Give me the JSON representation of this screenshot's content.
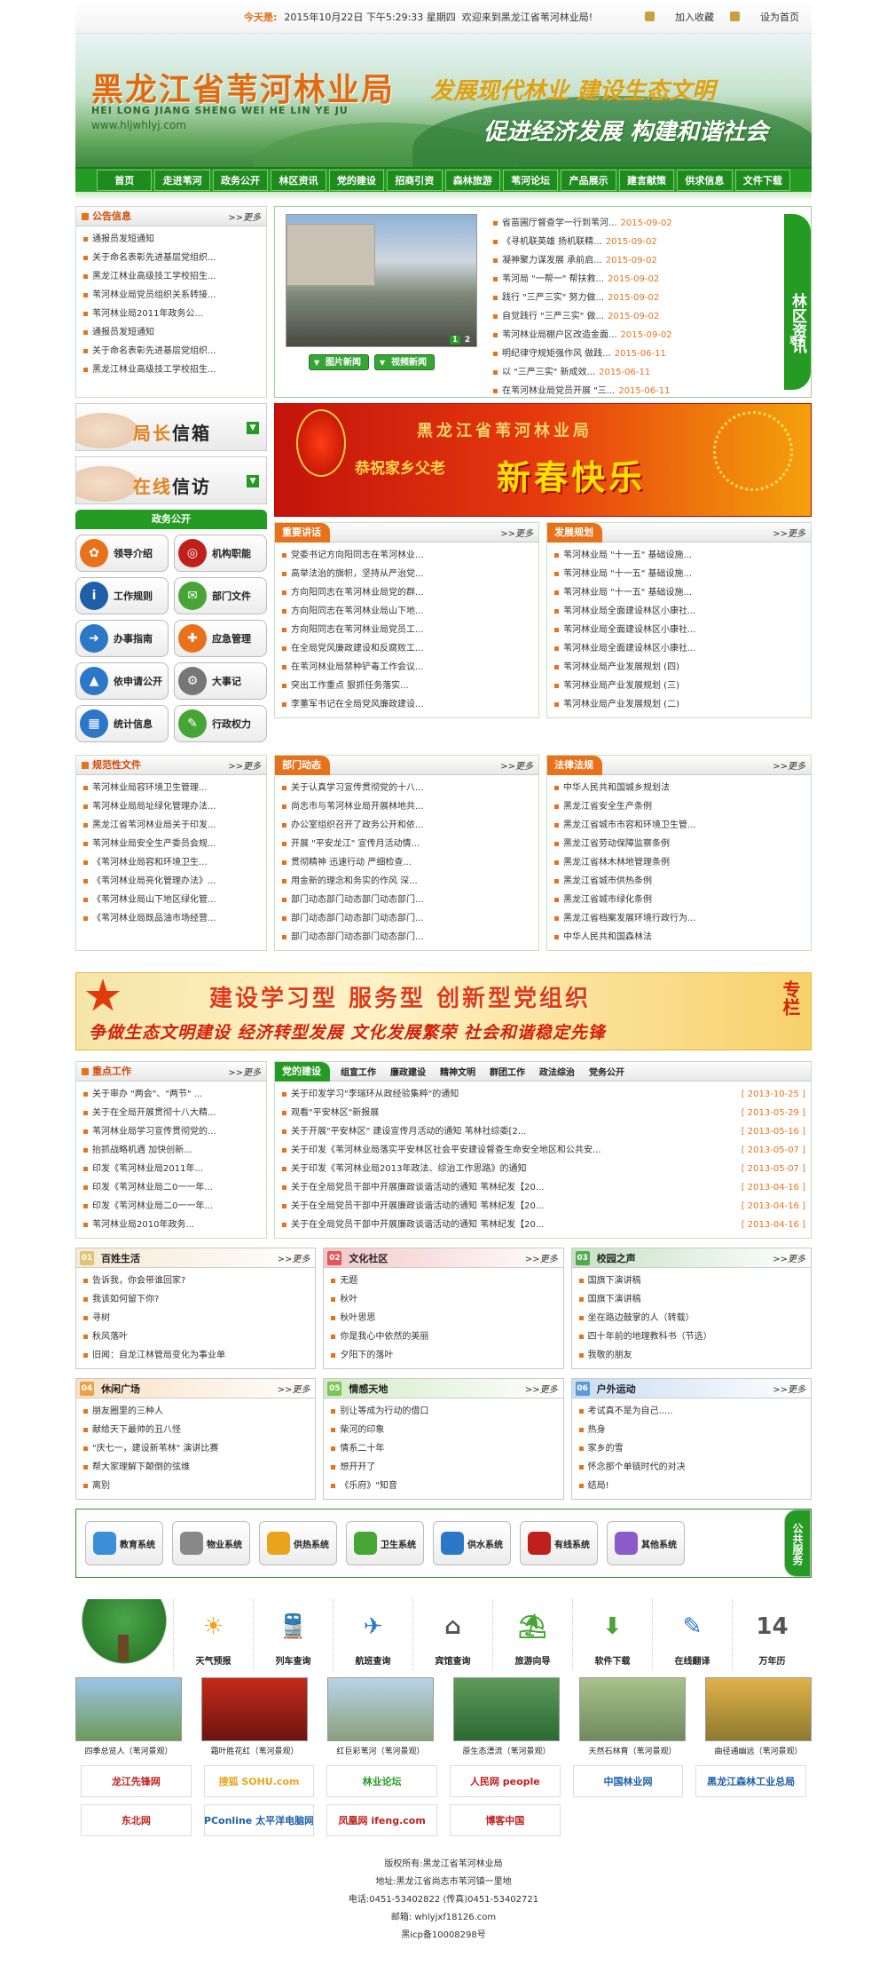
{
  "top": {
    "date_label": "今天是:",
    "date": "2015年10月22日 下午5:29:33 星期四",
    "welcome": "欢迎来到黑龙江省苇河林业局!",
    "fav": "加入收藏",
    "home": "设为首页"
  },
  "banner": {
    "site": "黑龙江省苇河林业局",
    "pinyin": "HEI LONG JIANG SHENG WEI HE LIN YE JU",
    "url": "www.hljwhlyj.com",
    "slogan1": "发展现代林业  建设生态文明",
    "slogan2": "促进经济发展  构建和谐社会"
  },
  "nav": [
    "首页",
    "走进苇河",
    "政务公开",
    "林区资讯",
    "党的建设",
    "招商引资",
    "森林旅游",
    "苇河论坛",
    "产品展示",
    "建言献策",
    "供求信息",
    "文件下载"
  ],
  "more": ">>更多",
  "notice": {
    "title": "公告信息",
    "items": [
      "通报员发短通知",
      "关于命名表彰先进基层党组织...",
      "黑龙江林业高级技工学校招生...",
      "苇河林业局党员组织关系转接...",
      "苇河林业局2011年政务公...",
      "通报员发短通知",
      "关于命名表彰先进基层党组织...",
      "黑龙江林业高级技工学校招生..."
    ]
  },
  "photo_btns": [
    "图片新闻",
    "视频新闻"
  ],
  "photo_nums": [
    "1",
    "2"
  ],
  "news": [
    {
      "t": "省苗圃厅督查学一行到苇河...",
      "d": "2015-09-02"
    },
    {
      "t": "《寻机联英雄 扬机联精...",
      "d": "2015-09-02"
    },
    {
      "t": "凝神聚力谋发展 承前启...",
      "d": "2015-09-02"
    },
    {
      "t": "苇河局 \"一帮一\" 帮扶救...",
      "d": "2015-09-02"
    },
    {
      "t": "践行 \"三严三实\" 努力做...",
      "d": "2015-09-02"
    },
    {
      "t": "自觉践行 \"三严三实\" 做...",
      "d": "2015-09-02"
    },
    {
      "t": "苇河林业局棚户区改造金面...",
      "d": "2015-09-02"
    },
    {
      "t": "明纪律守规矩强作风 做践...",
      "d": "2015-06-11"
    },
    {
      "t": "以 \"三严三实\" 新成效...",
      "d": "2015-06-11"
    },
    {
      "t": "在苇河林业局党员开展 \"三...",
      "d": "2015-06-11"
    }
  ],
  "forest": {
    "title": "林区资讯",
    "more": "更多"
  },
  "side_btns": [
    {
      "a": "局长",
      "b": "信箱"
    },
    {
      "a": "在线",
      "b": "信访"
    }
  ],
  "gov": {
    "title": "政务公开",
    "items": [
      "领导介绍",
      "机构职能",
      "工作规则",
      "部门文件",
      "办事指南",
      "应急管理",
      "依申请公开",
      "大事记",
      "统计信息",
      "行政权力"
    ]
  },
  "spring": {
    "t1": "黑龙江省苇河林业局",
    "t2": "恭祝家乡父老",
    "t3": "新春快乐"
  },
  "speech": {
    "title": "重要讲话",
    "items": [
      "党委书记方向阳同志在苇河林业...",
      "高举法治的旗帜，坚持从严治党...",
      "方向阳同志在苇河林业局党的群...",
      "方向阳同志在苇河林业局山下地...",
      "方向阳同志在苇河林业局党员工...",
      "在全局党风廉政建设和反腐败工...",
      "在苇河林业局禁种铲毒工作会议...",
      "突出工作重点 狠抓任务落实...",
      "李董军书记在全局党风廉政建设..."
    ]
  },
  "plan": {
    "title": "发展规划",
    "items": [
      "苇河林业局 \"十一五\" 基础设施...",
      "苇河林业局 \"十一五\" 基础设施...",
      "苇河林业局 \"十一五\" 基础设施...",
      "苇河林业局全面建设林区小康社...",
      "苇河林业局全面建设林区小康社...",
      "苇河林业局全面建设林区小康社...",
      "苇河林业局产业发展规划 (四)",
      "苇河林业局产业发展规划 (三)",
      "苇河林业局产业发展规划 (二)"
    ]
  },
  "norm": {
    "title": "规范性文件",
    "items": [
      "苇河林业局容环境卫生管理...",
      "苇河林业局局址绿化管理办法...",
      "黑龙江省苇河林业局关于印发...",
      "苇河林业局安全生产委员会规...",
      "《苇河林业局容和环境卫生...",
      "《苇河林业局亮化管理办法》...",
      "《苇河林业局山下地区绿化管...",
      "《苇河林业局既品油市场经营..."
    ]
  },
  "dept": {
    "title": "部门动态",
    "items": [
      "关于认真学习宣传贯彻党的十八...",
      "尚志市与苇河林业局开展林地共...",
      "办公室组织召开了政务公开和依...",
      "开展 \"平安龙江\" 宣传月活动情...",
      "贯彻精神 迅速行动 严细检查...",
      "用金新的理念和务实的作风 深...",
      "部门动态部门动态部门动态部门...",
      "部门动态部门动态部门动态部门...",
      "部门动态部门动态部门动态部门..."
    ]
  },
  "law": {
    "title": "法律法规",
    "items": [
      "中华人民共和国城乡规划法",
      "黑龙江省安全生产条例",
      "黑龙江省城市市容和环境卫生管...",
      "黑龙江省劳动保障监察条例",
      "黑龙江省林木林地管理条例",
      "黑龙江省城市供热条例",
      "黑龙江省城市绿化条例",
      "黑龙江省档案发展环境行政行为...",
      "中华人民共和国森林法"
    ]
  },
  "party_banner": {
    "a": "建设学习型  服务型  创新型党组织",
    "b": "争做生态文明建设 经济转型发展 文化发展繁荣 社会和谐稳定先锋",
    "c": "专栏"
  },
  "key": {
    "title": "重点工作",
    "items": [
      "关于审办 \"两会\"、\"两节\" ...",
      "关于在全局开展贯彻十八大精...",
      "苇河林业局学习宣传贯彻党的...",
      "抬抓战略机遇 加快创新...",
      "印发《苇河林业局2011年...",
      "印发《苇河林业局二0一一年...",
      "印发《苇河林业局二0一一年...",
      "苇河林业局2010年政务..."
    ]
  },
  "partybuild": {
    "title": "党的建设",
    "tabs": [
      "组宣工作",
      "廉政建设",
      "精神文明",
      "群团工作",
      "政法综治",
      "党务公开"
    ],
    "items": [
      {
        "t": "关于印发学习\"李瑞环从政经验集粹\"的通知",
        "d": "[ 2013-10-25 ]"
      },
      {
        "t": "观看\"平安林区\"新报展",
        "d": "[ 2013-05-29 ]"
      },
      {
        "t": "关于开展\"平安林区\" 建设宣传月活动的通知 苇林社综委[2...",
        "d": "[ 2013-05-16 ]"
      },
      {
        "t": "关于印发《苇河林业局落实平安林区社会平安建设督查生命安全地区和公共安...",
        "d": "[ 2013-05-07 ]"
      },
      {
        "t": "关于印发《苇河林业局2013年政法、综治工作思路》的通知",
        "d": "[ 2013-05-07 ]"
      },
      {
        "t": "关于在全局党员干部中开展廉政谈谐活动的通知 苇林纪发【20...",
        "d": "[ 2013-04-16 ]"
      },
      {
        "t": "关于在全局党员干部中开展廉政谈谐活动的通知 苇林纪发【20...",
        "d": "[ 2013-04-16 ]"
      },
      {
        "t": "关于在全局党员干部中开展廉政谈谐活动的通知 苇林纪发【20...",
        "d": "[ 2013-04-16 ]"
      }
    ]
  },
  "cats": [
    {
      "title": "百姓生活",
      "num": "01",
      "color": "#e3c27a",
      "items": [
        "告诉我，你会带谁回家?",
        "我该如何留下你?",
        "寻树",
        "秋风落叶",
        "旧闻：自龙江林管局变化为事业单"
      ]
    },
    {
      "title": "文化社区",
      "num": "02",
      "color": "#e05858",
      "items": [
        "无题",
        "秋叶",
        "秋叶思思",
        "你是我心中依然的美丽",
        "夕阳下的落叶"
      ]
    },
    {
      "title": "校园之声",
      "num": "03",
      "color": "#55a850",
      "items": [
        "国旗下演讲稿",
        "国旗下演讲稿",
        "坐在路边鼓掌的人（转载）",
        "四十年前的地理教科书（节选）",
        "我敬的朋友"
      ]
    },
    {
      "title": "休闲广场",
      "num": "04",
      "color": "#e8a44a",
      "items": [
        "朋友圈里的三种人",
        "献给天下最帅的丑八怪",
        "\"庆七一，建设新苇林\" 演讲比赛",
        "帮大家理解下颠倒的弦维",
        "离别"
      ]
    },
    {
      "title": "情感天地",
      "num": "05",
      "color": "#7cc455",
      "items": [
        "别让等成为行动的借口",
        "柴河的印象",
        "情系二十年",
        "想开开了",
        "《乐府》\"知音"
      ]
    },
    {
      "title": "户外运动",
      "num": "06",
      "color": "#5c9ad8",
      "items": [
        "考试真不是为自己.....",
        "热身",
        "家乡的雪",
        "怀念那个单链时代的对决",
        "结局!"
      ]
    }
  ],
  "services": {
    "items": [
      "教育系统",
      "物业系统",
      "供热系统",
      "卫生系统",
      "供水系统",
      "有线系统",
      "其他系统"
    ],
    "side": "公共服务"
  },
  "tools": [
    "天气预报",
    "列车查询",
    "航班查询",
    "宾馆查询",
    "旅游向导",
    "软件下载",
    "在线翻译",
    "万年历"
  ],
  "scenic": [
    "四季总览人（苇河景观）",
    "霜叶胜花红（苇河景观）",
    "红巨彩苇河（苇河景观）",
    "原生态漂流（苇河景观）",
    "天然石林育（苇河景观）",
    "曲径通幽远（苇河景观）"
  ],
  "logos": [
    {
      "t": "龙江先锋网",
      "c": "#c0201c"
    },
    {
      "t": "搜狐 SOHU.com",
      "c": "#e8a41c"
    },
    {
      "t": "林业论坛",
      "c": "#259b24"
    },
    {
      "t": "人民网 people",
      "c": "#c0201c"
    },
    {
      "t": "中国林业网",
      "c": "#1d5fa8"
    },
    {
      "t": "黑龙江森林工业总局",
      "c": "#1d5fa8"
    },
    {
      "t": "东北网",
      "c": "#c0201c"
    },
    {
      "t": "PConline 太平洋电脑网",
      "c": "#1d5fa8"
    },
    {
      "t": "凤凰网 ifeng.com",
      "c": "#c0201c"
    },
    {
      "t": "博客中国",
      "c": "#c0201c"
    }
  ],
  "footer": [
    "版权所有:黑龙江省苇河林业局",
    "地址:黑龙江省尚志市苇河镇一里地",
    "电话:0451-53402822 (传真)0451-53402721",
    "邮箱: whlyjxf18126.com",
    "黑icp备10008298号"
  ]
}
